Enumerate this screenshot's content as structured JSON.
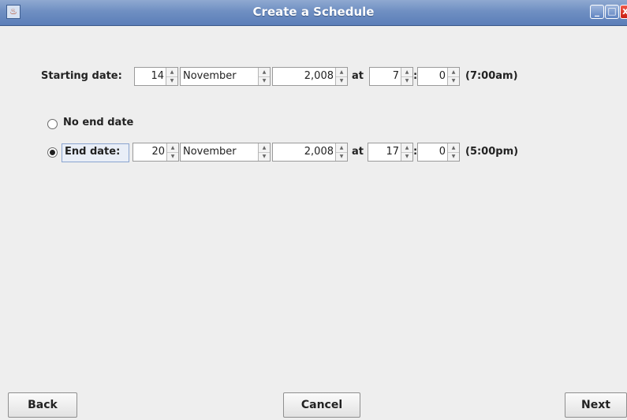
{
  "window": {
    "title": "Create a Schedule",
    "close_symbol": "x",
    "min_symbol": "_",
    "max_symbol": "□"
  },
  "start": {
    "label": "Starting date:",
    "day": "14",
    "month": "November",
    "year": "2,008",
    "at_label": "at",
    "hour": "7",
    "colon": ":",
    "minute": "0",
    "time_text": "(7:00am)"
  },
  "no_end": {
    "label": "No end date",
    "selected": false
  },
  "end": {
    "label": "End date:",
    "selected": true,
    "day": "20",
    "month": "November",
    "year": "2,008",
    "at_label": "at",
    "hour": "17",
    "colon": ":",
    "minute": "0",
    "time_text": "(5:00pm)"
  },
  "buttons": {
    "back": "Back",
    "cancel": "Cancel",
    "next": "Next"
  },
  "icons": {
    "spinner_up": "▲",
    "spinner_down": "▼"
  },
  "colors": {
    "titlebar": "#6f8fc2",
    "background": "#eeeeee",
    "close": "#c81e12"
  }
}
